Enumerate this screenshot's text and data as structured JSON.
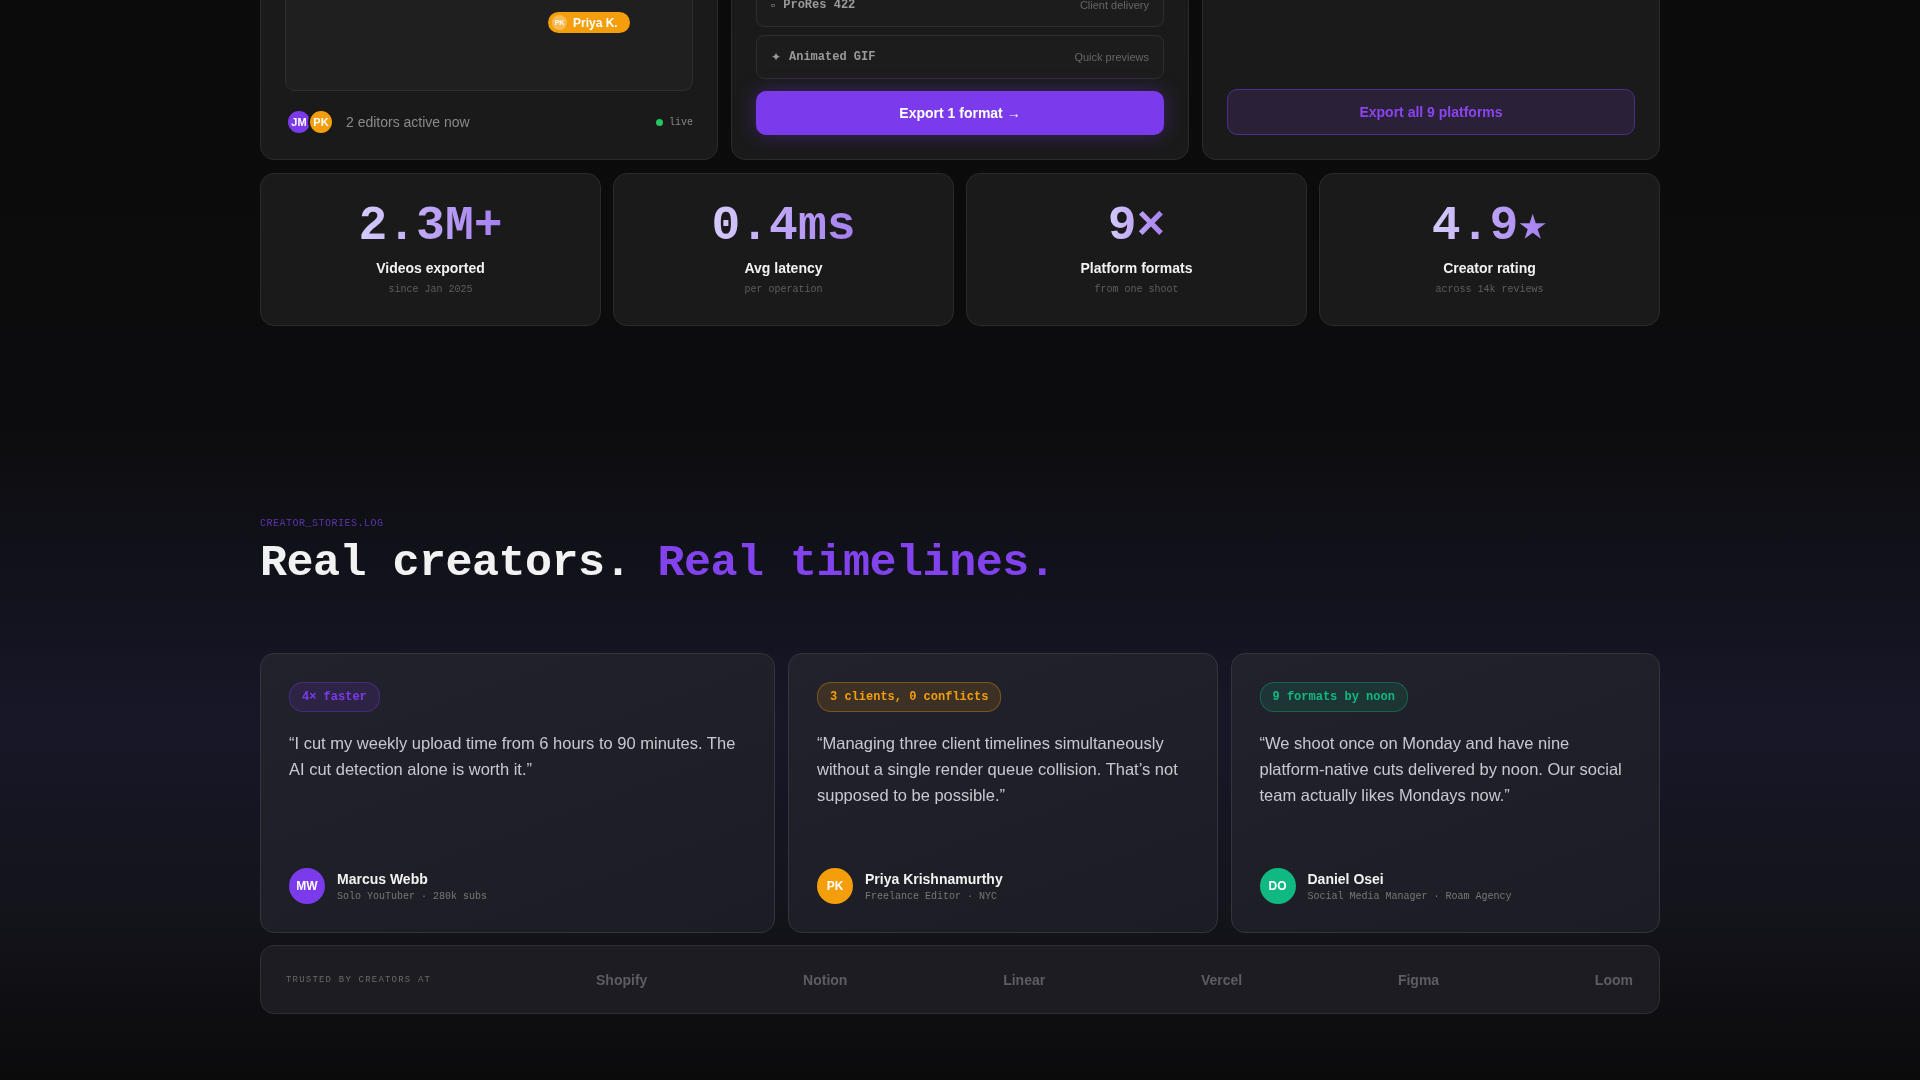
{
  "collab_panel": {
    "cursor": {
      "initials": "PK",
      "name": "Priya K.",
      "color": "#f59e0b"
    },
    "editors": [
      {
        "initials": "JM",
        "color": "#7c3aed"
      },
      {
        "initials": "PK",
        "color": "#f59e0b"
      }
    ],
    "presence": "2 editors active now",
    "status": "live"
  },
  "export_panel": {
    "formats": [
      {
        "icon": "▫",
        "name": "ProRes 422",
        "note": "Client delivery"
      },
      {
        "icon": "✦",
        "name": "Animated GIF",
        "note": "Quick previews"
      }
    ],
    "button": "Export 1 format →"
  },
  "platforms_panel": {
    "button": "Export all 9 platforms"
  },
  "stats": [
    {
      "value": "2.3M+",
      "label": "Videos exported",
      "caption": "since Jan 2025"
    },
    {
      "value": "0.4ms",
      "label": "Avg latency",
      "caption": "per operation"
    },
    {
      "value": "9×",
      "label": "Platform formats",
      "caption": "from one shoot"
    },
    {
      "value": "4.9★",
      "label": "Creator rating",
      "caption": "across 14k reviews"
    }
  ],
  "stories": {
    "eyebrow": "CREATOR_STORIES.LOG",
    "heading_lead": "Real creators.",
    "heading_accent": "Real timelines.",
    "cards": [
      {
        "tag": "4× faster",
        "color": "#7c3aed",
        "quote": "“I cut my weekly upload time from 6 hours to 90 minutes. The AI cut detection alone is worth it.”",
        "initials": "MW",
        "name": "Marcus Webb",
        "role": "Solo YouTuber · 280k subs"
      },
      {
        "tag": "3 clients, 0 conflicts",
        "color": "#f59e0b",
        "quote": "“Managing three client timelines simultaneously without a single render queue collision. That’s not supposed to be possible.”",
        "initials": "PK",
        "name": "Priya Krishnamurthy",
        "role": "Freelance Editor · NYC"
      },
      {
        "tag": "9 formats by noon",
        "color": "#10b981",
        "quote": "“We shoot once on Monday and have nine platform-native cuts delivered by noon. Our social team actually likes Mondays now.”",
        "initials": "DO",
        "name": "Daniel Osei",
        "role": "Social Media Manager · Roam Agency"
      }
    ]
  },
  "trusted": {
    "label": "TRUSTED BY CREATORS AT",
    "logos": [
      "Shopify",
      "Notion",
      "Linear",
      "Vercel",
      "Figma",
      "Loom"
    ]
  }
}
